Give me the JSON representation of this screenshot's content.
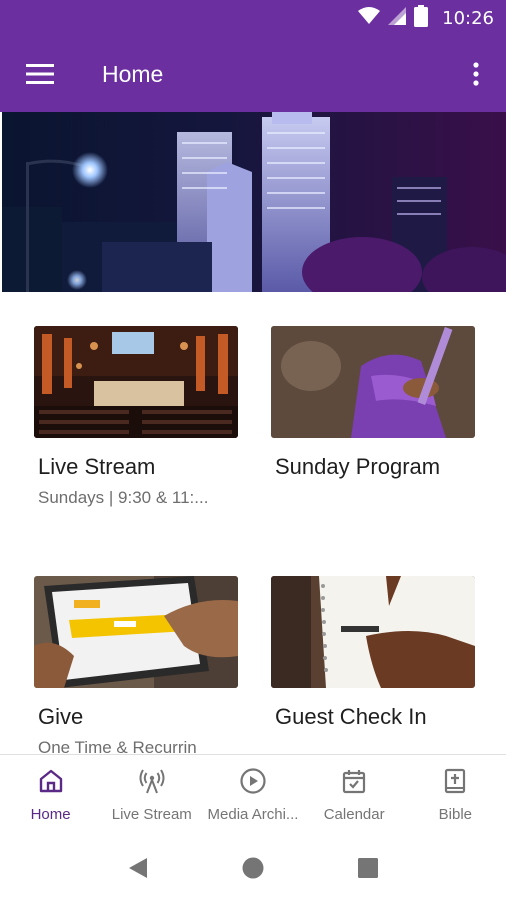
{
  "status_bar": {
    "time": "10:26",
    "icons": [
      "wifi-icon",
      "signal-icon",
      "battery-icon"
    ]
  },
  "app_bar": {
    "title": "Home",
    "menu_icon": "hamburger-icon",
    "overflow_icon": "more-vert-icon"
  },
  "colors": {
    "primary": "#6b2fa0",
    "active_nav": "#5b2a86",
    "title_text": "#1f1f1f",
    "subtitle_text": "#6e6e6e"
  },
  "cards": [
    {
      "title": "Live Stream",
      "subtitle": "Sundays | 9:30 & 11:..."
    },
    {
      "title": "Sunday Program",
      "subtitle": ""
    },
    {
      "title": "Give",
      "subtitle": "One Time & Recurrin"
    },
    {
      "title": "Guest Check In",
      "subtitle": ""
    }
  ],
  "bottom_nav": {
    "items": [
      {
        "label": "Home",
        "icon": "home-icon",
        "active": true
      },
      {
        "label": "Live Stream",
        "icon": "broadcast-icon",
        "active": false
      },
      {
        "label": "Media Archi...",
        "icon": "play-circle-icon",
        "active": false
      },
      {
        "label": "Calendar",
        "icon": "calendar-check-icon",
        "active": false
      },
      {
        "label": "Bible",
        "icon": "bible-icon",
        "active": false
      }
    ]
  },
  "system_nav": {
    "buttons": [
      "back-icon",
      "home-circle-icon",
      "recents-icon"
    ]
  }
}
